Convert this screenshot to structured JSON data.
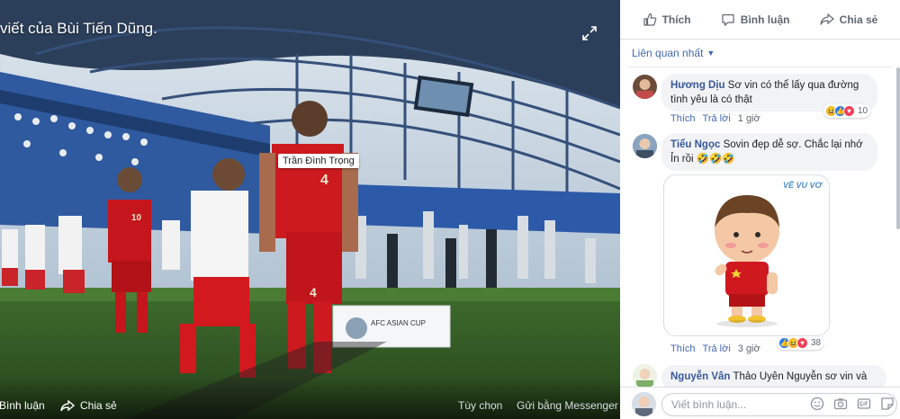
{
  "viewer": {
    "caption": "viết của Bùi Tiến Dũng.",
    "photo_tag": "Trần Đình Trọng",
    "banner_text": "AFC ASIAN CUP",
    "jersey_number": "4",
    "jersey_number_kid": "10",
    "bottom": {
      "comment": "Bình luận",
      "share": "Chia sẻ",
      "options": "Tùy chọn",
      "messenger": "Gửi bằng Messenger"
    }
  },
  "panel": {
    "actions": {
      "like": "Thích",
      "comment": "Bình luận",
      "share": "Chia sẻ"
    },
    "sort_label": "Liên quan nhất",
    "comments": [
      {
        "name": "Hương Dịu",
        "text": "Sơ vin có thể lấy qua đường tình yêu là có thật",
        "like": "Thích",
        "reply": "Trả lời",
        "time": "1 giờ",
        "reaction_count": "10"
      },
      {
        "name": "Tiểu Ngọc",
        "text": "Sovin đẹp dễ sợ. Chắc lại nhớ Ỉn rồi 🤣🤣🤣",
        "sticker_label": "VỀ VU VƠ",
        "like": "Thích",
        "reply": "Trả lời",
        "time": "3 giờ",
        "reaction_count": "38"
      },
      {
        "name": "Nguyễn Vân",
        "text": "Thảo Uyên Nguyễn sơ vin và"
      }
    ],
    "composer_placeholder": "Viết bình luận...",
    "colors": {
      "link": "#4267b2",
      "name": "#385898",
      "bubble": "#f2f3f5",
      "text": "#1c1e21",
      "muted": "#606770"
    }
  }
}
